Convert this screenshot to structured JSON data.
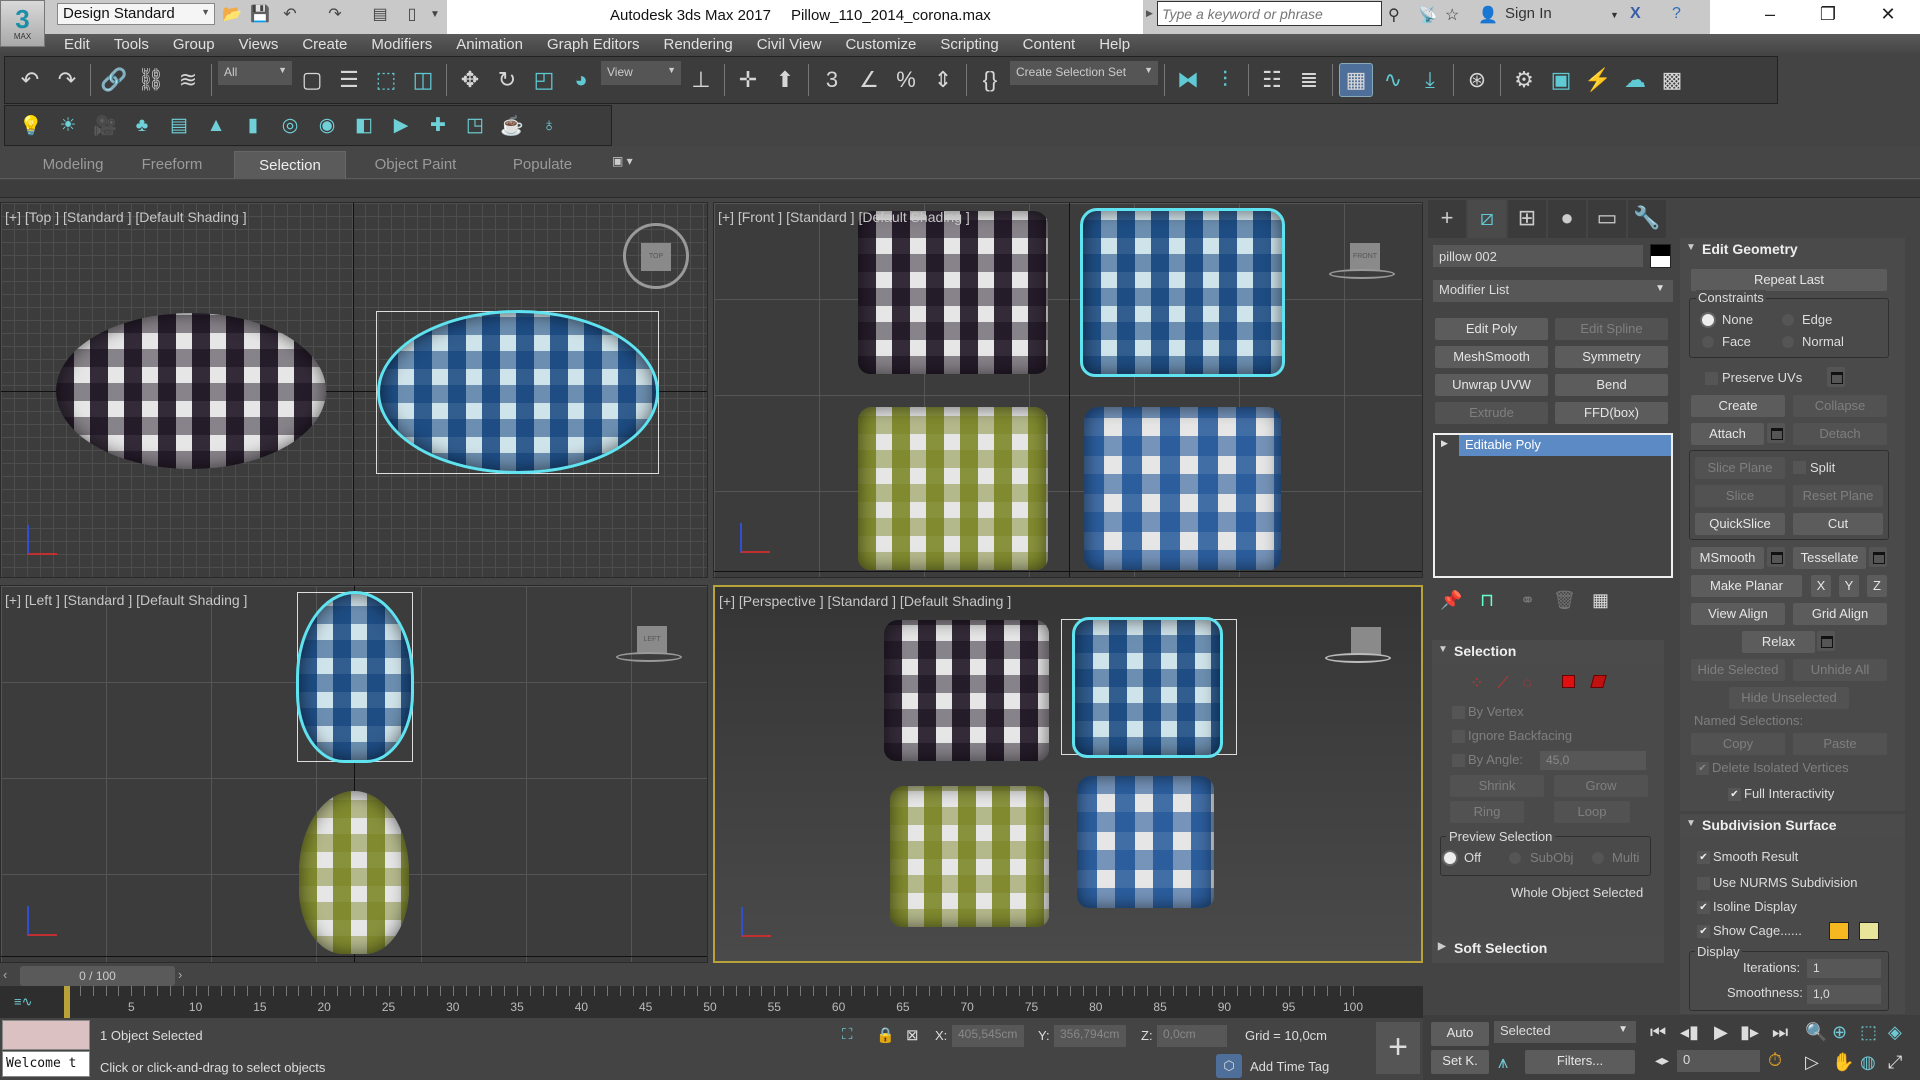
{
  "app": {
    "title": "Autodesk 3ds Max 2017",
    "file": "Pillow_110_2014_corona.max",
    "logo_number": "3",
    "logo_text": "MAX",
    "workspace": "Design Standard"
  },
  "infocenter": {
    "search_placeholder": "Type a keyword or phrase",
    "sign_in": "Sign In"
  },
  "menu": [
    "Edit",
    "Tools",
    "Group",
    "Views",
    "Create",
    "Modifiers",
    "Animation",
    "Graph Editors",
    "Rendering",
    "Civil View",
    "Customize",
    "Scripting",
    "Content",
    "Help"
  ],
  "toolbar": {
    "main": [
      {
        "i": "undo-icon"
      },
      {
        "i": "redo-icon"
      },
      "sep",
      {
        "i": "link-icon"
      },
      {
        "i": "unlink-icon"
      },
      {
        "i": "bind-space-warp-icon"
      },
      "sep",
      {
        "dd": "All",
        "w": 74
      },
      {
        "i": "select-object-icon"
      },
      {
        "i": "select-by-name-icon"
      },
      {
        "i": "rectangular-selection-icon",
        "a": 1
      },
      {
        "i": "window-crossing-icon",
        "a": 1
      },
      "sep",
      {
        "i": "move-icon"
      },
      {
        "i": "rotate-icon"
      },
      {
        "i": "scale-icon",
        "a": 1
      },
      {
        "i": "placement-icon",
        "a": 1
      },
      {
        "dd": "View",
        "w": 80
      },
      {
        "i": "pivot-icon"
      },
      "sep",
      {
        "i": "select-manipulate-icon"
      },
      {
        "i": "keyboard-shortcut-icon"
      },
      "sep",
      {
        "i": "snaps-toggle-icon"
      },
      {
        "i": "angle-snap-icon"
      },
      {
        "i": "percent-snap-icon"
      },
      {
        "i": "spinner-snap-icon"
      },
      "sep",
      {
        "i": "edit-named-selection-icon"
      },
      {
        "dd": "Create Selection Set",
        "w": 148
      },
      "sep",
      {
        "i": "mirror-icon",
        "a": 1
      },
      {
        "i": "align-icon",
        "a": 1
      },
      "sep",
      {
        "i": "scene-explorer-icon"
      },
      {
        "i": "layer-explorer-icon"
      },
      "sep",
      {
        "i": "toggle-ribbon-icon",
        "on": 1
      },
      {
        "i": "curve-editor-icon",
        "a": 1
      },
      {
        "i": "schematic-view-icon",
        "a": 1
      },
      "sep",
      {
        "i": "material-editor-icon"
      },
      "sep",
      {
        "i": "render-setup-icon"
      },
      {
        "i": "rendered-frame-window-icon",
        "a": 1
      },
      {
        "i": "render-production-icon"
      },
      {
        "i": "render-cloud-icon",
        "a": 1
      },
      {
        "i": "render-gallery-icon"
      }
    ],
    "secondary": [
      "light-icon",
      "sun-icon",
      "camera-icon",
      "scatter-icon",
      "layer-list-icon",
      "tree-icon",
      "proxy-icon",
      "interactive-render-icon",
      "material-icon",
      "frame-buffer-icon",
      "render-view-icon",
      "camera-plus-icon",
      "converter-icon",
      "teapot-icon",
      "light-lister-icon"
    ]
  },
  "ribbon": {
    "tabs": [
      "Modeling",
      "Freeform",
      "Selection",
      "Object Paint",
      "Populate"
    ],
    "active": "Selection"
  },
  "viewports": {
    "top": "[+] [Top ] [Standard ] [Default Shading ]",
    "front": "[+] [Front ] [Standard ] [Default Shading ]",
    "left": "[+] [Left ] [Standard ] [Default Shading ]",
    "perspective": "[+] [Perspective ] [Standard ] [Default Shading ]",
    "cube_front": "FRONT",
    "cube_left": "LEFT",
    "cube_top": "TOP"
  },
  "command_panel": {
    "object_name": "pillow 002",
    "object_color": "#000000",
    "modifier_list": "Modifier List",
    "modifier_buttons": [
      {
        "label": "Edit Poly",
        "enabled": true
      },
      {
        "label": "Edit Spline",
        "enabled": false
      },
      {
        "label": "MeshSmooth",
        "enabled": true
      },
      {
        "label": "Symmetry",
        "enabled": true
      },
      {
        "label": "Unwrap UVW",
        "enabled": true
      },
      {
        "label": "Bend",
        "enabled": true
      },
      {
        "label": "Extrude",
        "enabled": false
      },
      {
        "label": "FFD(box)",
        "enabled": true
      }
    ],
    "stack": [
      "Editable Poly"
    ],
    "selection": {
      "title": "Selection",
      "by_vertex": "By Vertex",
      "ignore_backfacing": "Ignore Backfacing",
      "by_angle": "By Angle:",
      "angle_value": "45,0",
      "shrink": "Shrink",
      "grow": "Grow",
      "ring": "Ring",
      "loop": "Loop",
      "preview_title": "Preview Selection",
      "preview_options": [
        "Off",
        "SubObj",
        "Multi"
      ],
      "preview_selected": "Off",
      "status": "Whole Object Selected"
    },
    "soft_selection": "Soft Selection",
    "edit_geometry": {
      "title": "Edit Geometry",
      "repeat_last": "Repeat Last",
      "constraints": "Constraints",
      "constraint_options": [
        "None",
        "Edge",
        "Face",
        "Normal"
      ],
      "constraint_selected": "None",
      "preserve_uvs": "Preserve UVs",
      "create": "Create",
      "collapse": "Collapse",
      "attach": "Attach",
      "detach": "Detach",
      "slice_plane": "Slice Plane",
      "split": "Split",
      "slice": "Slice",
      "reset_plane": "Reset Plane",
      "quickslice": "QuickSlice",
      "cut": "Cut",
      "msmooth": "MSmooth",
      "tessellate": "Tessellate",
      "make_planar": "Make Planar",
      "x": "X",
      "y": "Y",
      "z": "Z",
      "view_align": "View Align",
      "grid_align": "Grid Align",
      "relax": "Relax",
      "hide_selected": "Hide Selected",
      "unhide_all": "Unhide All",
      "hide_unselected": "Hide Unselected",
      "named_selections": "Named Selections:",
      "copy": "Copy",
      "paste": "Paste",
      "delete_isolated": "Delete Isolated Vertices",
      "full_interactivity": "Full Interactivity"
    },
    "subdivision": {
      "title": "Subdivision Surface",
      "smooth_result": "Smooth Result",
      "smooth_result_checked": true,
      "use_nurms": "Use NURMS Subdivision",
      "use_nurms_checked": false,
      "isoline": "Isoline Display",
      "isoline_checked": true,
      "show_cage": "Show Cage......",
      "show_cage_checked": true,
      "cage_colors": [
        "#f5b820",
        "#e8e49a"
      ],
      "display": "Display",
      "iterations_label": "Iterations:",
      "iterations": "1",
      "smoothness_label": "Smoothness:",
      "smoothness": "1,0"
    }
  },
  "timeline": {
    "position": "0 / 100",
    "start": 0,
    "end": 100,
    "current": 0,
    "label_step": 5
  },
  "status": {
    "selected": "1 Object Selected",
    "prompt": "Click or click-and-drag to select objects",
    "maxscript": "Welcome t",
    "x_label": "X:",
    "x": "405,545cm",
    "y_label": "Y:",
    "y": "356,794cm",
    "z_label": "Z:",
    "z": "0,0cm",
    "grid": "Grid = 10,0cm",
    "add_time_tag": "Add Time Tag"
  },
  "animation": {
    "auto": "Auto",
    "set_key": "Set K.",
    "key_filter": "Selected",
    "filters": "Filters...",
    "frame": "0"
  }
}
